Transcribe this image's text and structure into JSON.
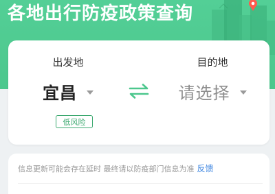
{
  "header": {
    "title": "各地出行防疫政策查询"
  },
  "route": {
    "origin": {
      "label": "出发地",
      "city": "宜昌",
      "risk_level": "低风险"
    },
    "destination": {
      "label": "目的地",
      "city_placeholder": "请选择"
    },
    "swap_icon": "swap-arrows-icon"
  },
  "notice": {
    "text": "信息更新可能会存在延时 最终请以防疫部门信息为准",
    "feedback_link": "反馈"
  },
  "colors": {
    "brand_green": "#4cc78d",
    "risk_green": "#3aa86e",
    "link_blue": "#3f86e0"
  }
}
